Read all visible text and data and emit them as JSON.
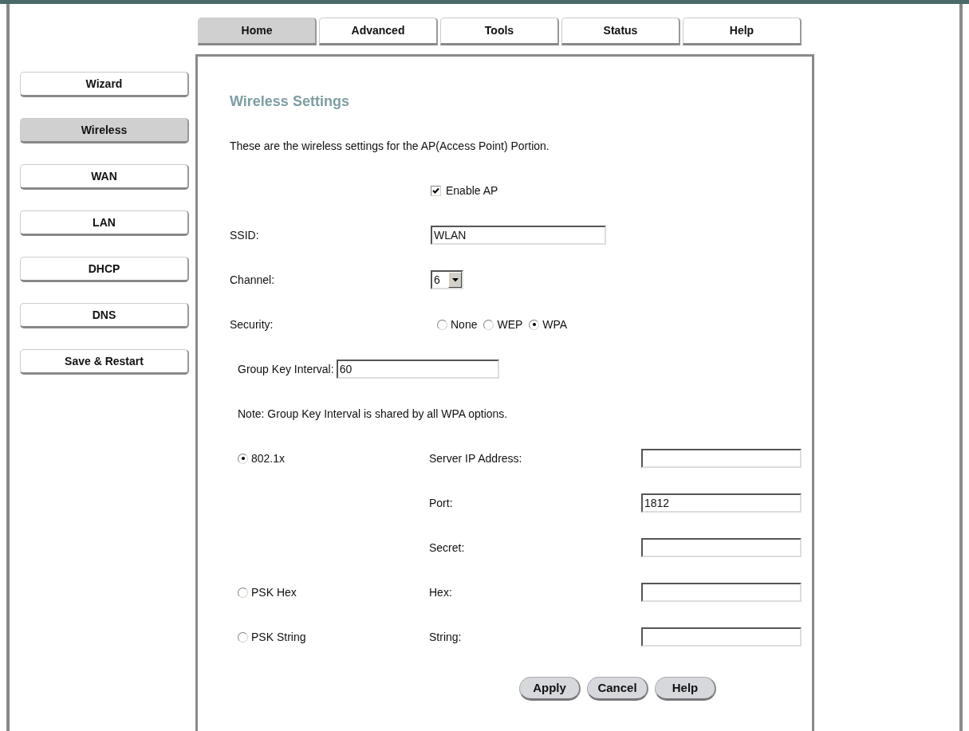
{
  "top_tabs": [
    {
      "label": "Home",
      "selected": true
    },
    {
      "label": "Advanced",
      "selected": false
    },
    {
      "label": "Tools",
      "selected": false
    },
    {
      "label": "Status",
      "selected": false
    },
    {
      "label": "Help",
      "selected": false
    }
  ],
  "sidebar": [
    {
      "label": "Wizard",
      "selected": false
    },
    {
      "label": "Wireless",
      "selected": true
    },
    {
      "label": "WAN",
      "selected": false
    },
    {
      "label": "LAN",
      "selected": false
    },
    {
      "label": "DHCP",
      "selected": false
    },
    {
      "label": "DNS",
      "selected": false
    },
    {
      "label": "Save & Restart",
      "selected": false
    }
  ],
  "content": {
    "title": "Wireless Settings",
    "description": "These are the wireless settings for the AP(Access Point) Portion.",
    "enable_ap": {
      "label": "Enable AP",
      "checked": true
    },
    "ssid": {
      "label": "SSID:",
      "value": "WLAN"
    },
    "channel": {
      "label": "Channel:",
      "value": "6"
    },
    "security": {
      "label": "Security:",
      "options": [
        {
          "label": "None",
          "selected": false
        },
        {
          "label": "WEP",
          "selected": false
        },
        {
          "label": "WPA",
          "selected": true
        }
      ]
    },
    "group_key_interval": {
      "label": "Group Key Interval:",
      "value": "60"
    },
    "note": "Note: Group Key Interval is shared by all WPA options.",
    "wpa_options": [
      {
        "label": "802.1x",
        "selected": true,
        "fields": [
          {
            "label": "Server IP Address:"
          },
          {
            "label": "Port:",
            "value": "1812"
          },
          {
            "label": "Secret:"
          }
        ]
      },
      {
        "label": "PSK Hex",
        "selected": false,
        "fields": [
          {
            "label": "Hex:"
          }
        ]
      },
      {
        "label": "PSK String",
        "selected": false,
        "fields": [
          {
            "label": "String:"
          }
        ]
      }
    ],
    "buttons": [
      "Apply",
      "Cancel",
      "Help"
    ]
  }
}
